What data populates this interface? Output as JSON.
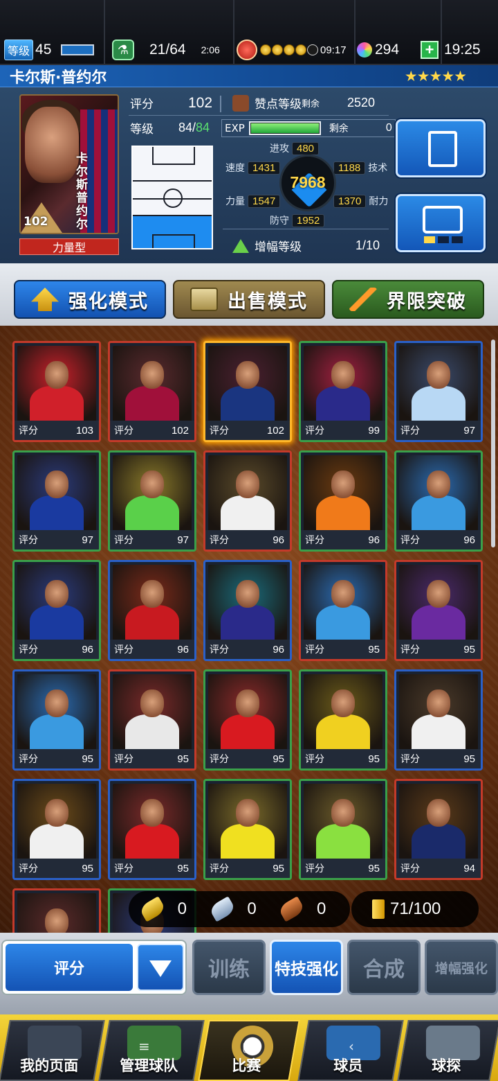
{
  "topbar": {
    "level_label": "等级",
    "level_value": "45",
    "stamina": "21/64",
    "stamina_timer": "2:06",
    "coin_timer": "09:17",
    "gems": "294",
    "clock": "19:25"
  },
  "player": {
    "name": "卡尔斯·普约尔",
    "stars": "★★★★★",
    "card_name_vertical": "卡尔斯普约尔",
    "card_rating": "102",
    "type": "力量型",
    "rating_label": "评分",
    "rating_value": "102",
    "praise_label": "赞点等级",
    "praise_remaining_label": "剩余",
    "praise_remaining_value": "2520",
    "level_label": "等级",
    "level_current": "84",
    "level_sep": "/",
    "level_max": "84",
    "exp_label": "EXP",
    "exp_remaining_label": "剩余",
    "exp_remaining_value": "0",
    "exp_fill": 1.0,
    "attack_label": "进攻",
    "attack_value": "480",
    "speed_label": "速度",
    "speed_value": "1431",
    "technique_label": "技术",
    "technique_value": "1188",
    "power_label": "力量",
    "power_value": "1547",
    "stamina_label": "耐力",
    "stamina_value": "1370",
    "defense_label": "防守",
    "defense_value": "1952",
    "total_value": "7968",
    "boost_label": "增幅等级",
    "boost_value": "1/10"
  },
  "tabs": [
    {
      "label": "强化模式",
      "color": "#1d6ad0"
    },
    {
      "label": "出售模式",
      "color": "#8a7440"
    },
    {
      "label": "界限突破",
      "color": "#3a7a2a"
    }
  ],
  "cards": [
    {
      "label": "评分",
      "rating": "103",
      "border": "#c43a2a",
      "bg": "#c8202a",
      "shirt": "#d0202a"
    },
    {
      "label": "评分",
      "rating": "102",
      "border": "#c43a2a",
      "bg": "#5a2a2e",
      "shirt": "#a0103a"
    },
    {
      "label": "评分",
      "rating": "102",
      "border": "#ffb82a",
      "bg": "#4a2030",
      "shirt": "#1a3580",
      "selected": true
    },
    {
      "label": "评分",
      "rating": "99",
      "border": "#3aa04a",
      "bg": "#a02040",
      "shirt": "#2a2a8a"
    },
    {
      "label": "评分",
      "rating": "97",
      "border": "#2a60c8",
      "bg": "#3a4a6a",
      "shirt": "#b8d8f4"
    },
    {
      "label": "评分",
      "rating": "97",
      "border": "#3aa04a",
      "bg": "#2a3a7a",
      "shirt": "#1a3aa0"
    },
    {
      "label": "评分",
      "rating": "97",
      "border": "#3aa04a",
      "bg": "#8a7a2a",
      "shirt": "#5ad04a"
    },
    {
      "label": "评分",
      "rating": "96",
      "border": "#c43a2a",
      "bg": "#5a4a2a",
      "shirt": "#f0f0f0"
    },
    {
      "label": "评分",
      "rating": "96",
      "border": "#3aa04a",
      "bg": "#6a3a10",
      "shirt": "#f07a1a"
    },
    {
      "label": "评分",
      "rating": "96",
      "border": "#3aa04a",
      "bg": "#2a6ab0",
      "shirt": "#3a9ae0"
    },
    {
      "label": "评分",
      "rating": "96",
      "border": "#3aa04a",
      "bg": "#2a3a7a",
      "shirt": "#1a3aa0"
    },
    {
      "label": "评分",
      "rating": "96",
      "border": "#2a60c8",
      "bg": "#7a2a1a",
      "shirt": "#c81a20"
    },
    {
      "label": "评分",
      "rating": "96",
      "border": "#2a60c8",
      "bg": "#1a6a7a",
      "shirt": "#2a2a8a"
    },
    {
      "label": "评分",
      "rating": "95",
      "border": "#c43a2a",
      "bg": "#2a6ab0",
      "shirt": "#3a9ae0"
    },
    {
      "label": "评分",
      "rating": "95",
      "border": "#c43a2a",
      "bg": "#4a2a6a",
      "shirt": "#6a2aa0"
    },
    {
      "label": "评分",
      "rating": "95",
      "border": "#2a60c8",
      "bg": "#2a6ab0",
      "shirt": "#3a9ae0"
    },
    {
      "label": "评分",
      "rating": "95",
      "border": "#c43a2a",
      "bg": "#7a2a2a",
      "shirt": "#e8e8e8"
    },
    {
      "label": "评分",
      "rating": "95",
      "border": "#3aa04a",
      "bg": "#8a2a2a",
      "shirt": "#d81a20"
    },
    {
      "label": "评分",
      "rating": "95",
      "border": "#3aa04a",
      "bg": "#6a5a1a",
      "shirt": "#f0d020"
    },
    {
      "label": "评分",
      "rating": "95",
      "border": "#2a60c8",
      "bg": "#4a3a2a",
      "shirt": "#f0f0f0"
    },
    {
      "label": "评分",
      "rating": "95",
      "border": "#2a60c8",
      "bg": "#6a4a1a",
      "shirt": "#f0f0f0"
    },
    {
      "label": "评分",
      "rating": "95",
      "border": "#2a60c8",
      "bg": "#7a2a2a",
      "shirt": "#d81a20"
    },
    {
      "label": "评分",
      "rating": "95",
      "border": "#3aa04a",
      "bg": "#7a6a2a",
      "shirt": "#f0e020"
    },
    {
      "label": "评分",
      "rating": "95",
      "border": "#3aa04a",
      "bg": "#6a5a2a",
      "shirt": "#8ae040"
    },
    {
      "label": "评分",
      "rating": "94",
      "border": "#c43a2a",
      "bg": "#5a3a1a",
      "shirt": "#1a2a6a"
    },
    {
      "label": "",
      "rating": "",
      "border": "#c43a2a",
      "bg": "#5a2a2a",
      "shirt": "#a01a2a"
    },
    {
      "label": "",
      "rating": "",
      "border": "#3aa04a",
      "bg": "#2a3a7a",
      "shirt": "#1a3aa0"
    }
  ],
  "resources": {
    "gold_boot": "0",
    "silver_boot": "0",
    "bronze_boot": "0",
    "capacity": "71/100"
  },
  "actions": {
    "sort_label": "评分",
    "train": "训练",
    "skill_boost": "特技强化",
    "combine": "合成",
    "amp_boost": "增幅强化"
  },
  "nav": [
    {
      "label": "我的页面"
    },
    {
      "label": "管理球队"
    },
    {
      "label": "比赛"
    },
    {
      "label": "球员"
    },
    {
      "label": "球探"
    }
  ]
}
